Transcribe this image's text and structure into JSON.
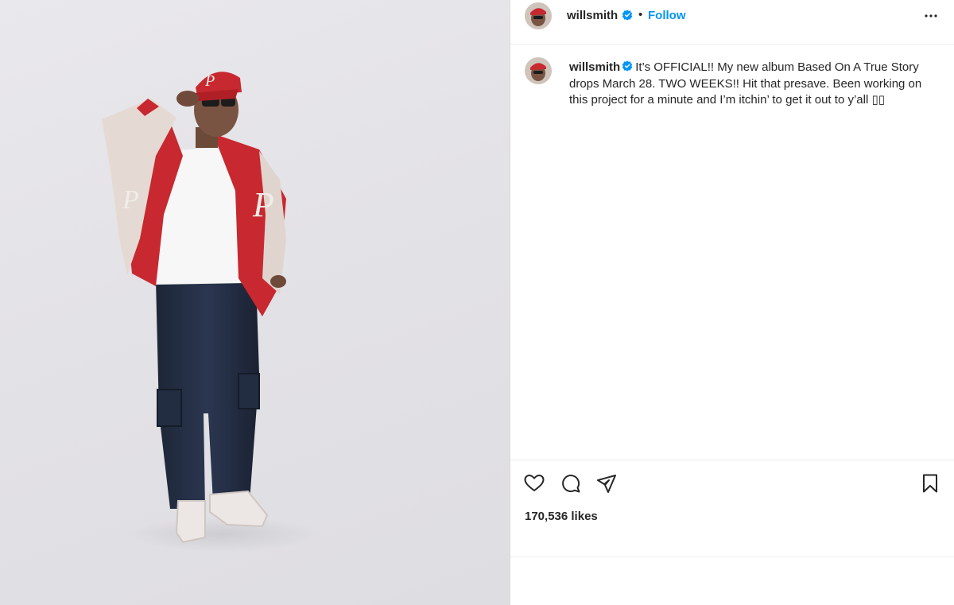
{
  "post": {
    "photo_alt": "Man in red varsity jacket and cap posing against a light gray background",
    "author": {
      "username": "willsmith",
      "verified": true,
      "follow_label": "Follow",
      "separator": "•"
    },
    "caption": {
      "username": "willsmith",
      "text": "It’s OFFICIAL!! My new album Based On A True Story drops March 28. TWO WEEKS!! Hit that presave. Been working on this project for a minute and I’m itchin’ to get it out to y’all ▯▯"
    },
    "actions": {
      "like_icon": "heart-icon",
      "comment_icon": "comment-icon",
      "share_icon": "share-icon",
      "save_icon": "bookmark-icon"
    },
    "likes_text": "170,536 likes",
    "colors": {
      "accent": "#0095f6",
      "text": "#262626",
      "jacket_red": "#c8282f"
    }
  }
}
